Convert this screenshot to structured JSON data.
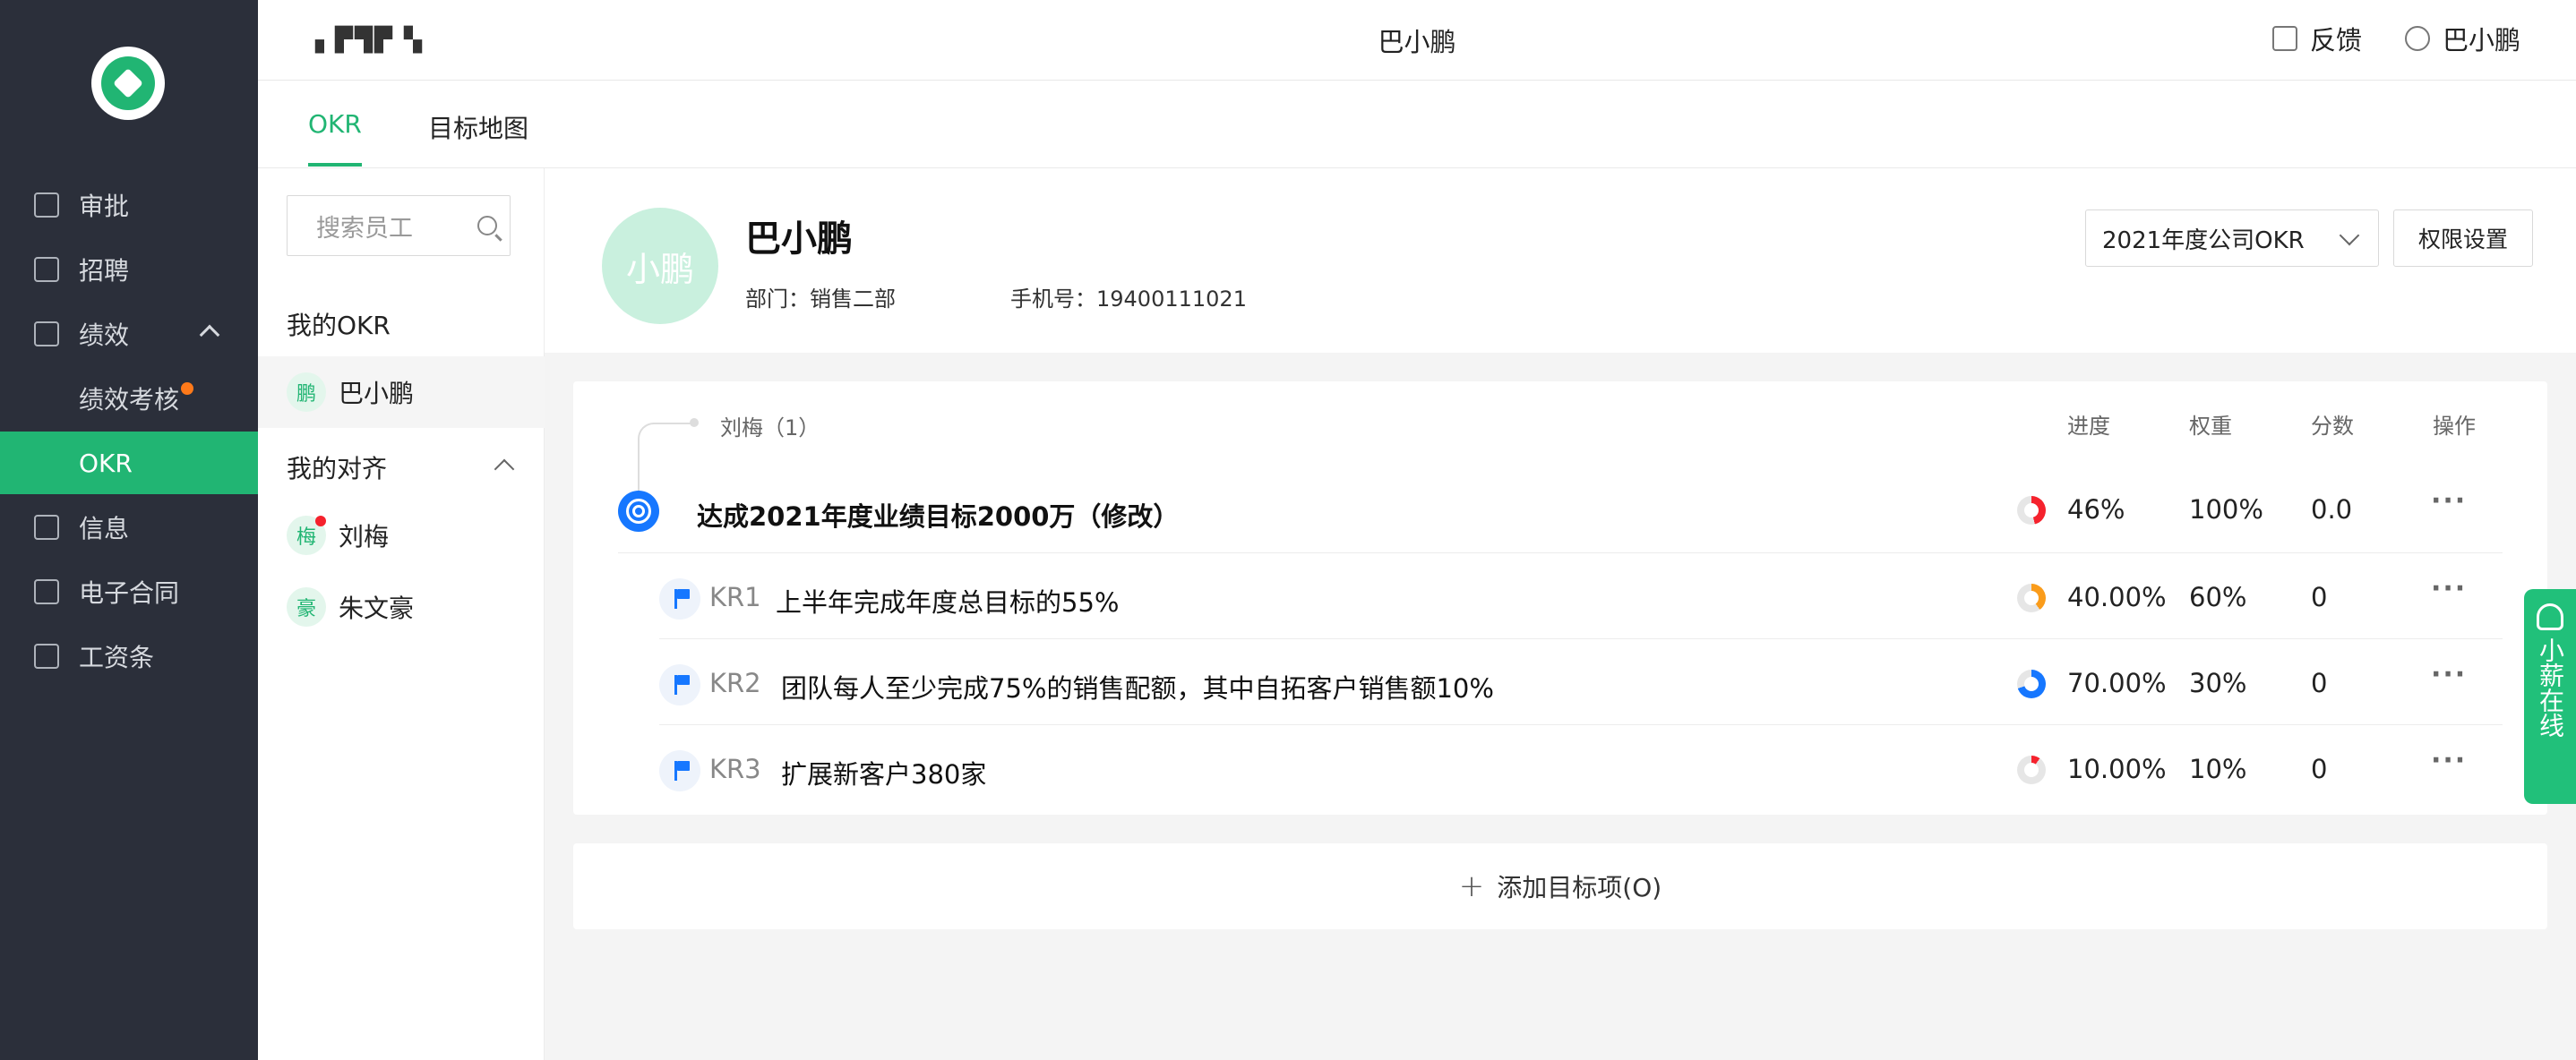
{
  "app": {
    "brand": "▖▛▜▛ ▚",
    "header_title": "巴小鹏"
  },
  "header": {
    "feedback_label": "反馈",
    "user_label": "巴小鹏"
  },
  "sidebar": {
    "items": [
      {
        "label": "审批"
      },
      {
        "label": "招聘"
      },
      {
        "label": "绩效"
      },
      {
        "label": "绩效考核"
      },
      {
        "label": "OKR"
      },
      {
        "label": "信息"
      },
      {
        "label": "电子合同"
      },
      {
        "label": "工资条"
      }
    ],
    "accent": "#21b573"
  },
  "tabs": [
    {
      "label": "OKR",
      "active": true
    },
    {
      "label": "目标地图",
      "active": false
    }
  ],
  "employees": {
    "search_placeholder": "搜索员工",
    "my_okr_label": "我的OKR",
    "my_okr": [
      {
        "avatar": "鹏",
        "name": "巴小鹏"
      }
    ],
    "alignment_label": "我的对齐",
    "alignment": [
      {
        "avatar": "梅",
        "name": "刘梅"
      },
      {
        "avatar": "豪",
        "name": "朱文豪"
      }
    ]
  },
  "profile": {
    "avatar_text": "小鹏",
    "name": "巴小鹏",
    "dept": "部门：销售二部",
    "phone": "手机号：19400111021",
    "period_select": "2021年度公司OKR",
    "permission_button": "权限设置"
  },
  "okr": {
    "aligned_to": "刘梅（1）",
    "columns": {
      "progress": "进度",
      "weight": "权重",
      "score": "分数",
      "actions": "操作"
    },
    "objective": {
      "title": "达成2021年度业绩目标2000万（修改）",
      "progress_value": 0.46,
      "progress": "46%",
      "weight": "100%",
      "score": "0.0",
      "ring_color": "#f5222d"
    },
    "key_results": [
      {
        "id": "KR1",
        "title": "上半年完成年度总目标的55%",
        "progress_value": 0.4,
        "progress": "40.00%",
        "weight": "60%",
        "score": "0",
        "ring_color": "#fa9c1b"
      },
      {
        "id": "KR2",
        "title": "团队每人至少完成75%的销售配额，其中自拓客户销售额10%",
        "progress_value": 0.7,
        "progress": "70.00%",
        "weight": "30%",
        "score": "0",
        "ring_color": "#1677ff"
      },
      {
        "id": "KR3",
        "title": "扩展新客户380家",
        "progress_value": 0.1,
        "progress": "10.00%",
        "weight": "10%",
        "score": "0",
        "ring_color": "#f5222d"
      }
    ],
    "more_label": "···"
  },
  "add_objective": {
    "label": "添加目标项(O)"
  },
  "chat": {
    "label": "小薪在线"
  }
}
